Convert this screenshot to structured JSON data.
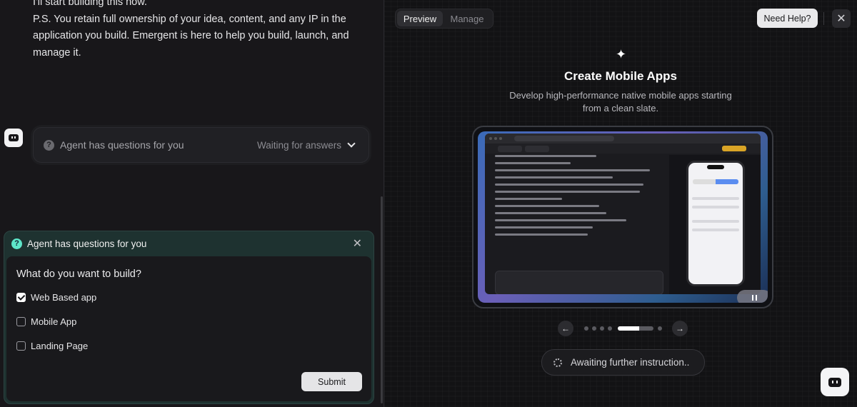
{
  "chat": {
    "message_lines": [
      "I'll start building this now.",
      "P.S. You retain full ownership of your idea, content, and any IP in the application you build. Emergent is here to help you build, launch, and manage it."
    ],
    "question_card": {
      "title": "Agent has questions for you",
      "status": "Waiting for answers"
    }
  },
  "questions_panel": {
    "title": "Agent has questions for you",
    "close_icon": "close-icon",
    "question": "What do you want to build?",
    "options": [
      {
        "label": "Web Based app",
        "checked": true
      },
      {
        "label": "Mobile App",
        "checked": false
      },
      {
        "label": "Landing Page",
        "checked": false
      }
    ],
    "submit_label": "Submit"
  },
  "preview": {
    "tabs": [
      {
        "label": "Preview",
        "active": true
      },
      {
        "label": "Manage",
        "active": false
      }
    ],
    "help_label": "Need Help?",
    "feature": {
      "icon": "sparkle-icon",
      "title": "Create Mobile Apps",
      "subtitle": "Develop high-performance native mobile apps starting from a clean slate."
    },
    "carousel": {
      "slides": 6,
      "active_index": 4,
      "active_progress": 0.6
    },
    "status": "Awaiting further instruction..",
    "colors": {
      "accent_teal": "#5ee6c9",
      "background": "#121214"
    }
  }
}
